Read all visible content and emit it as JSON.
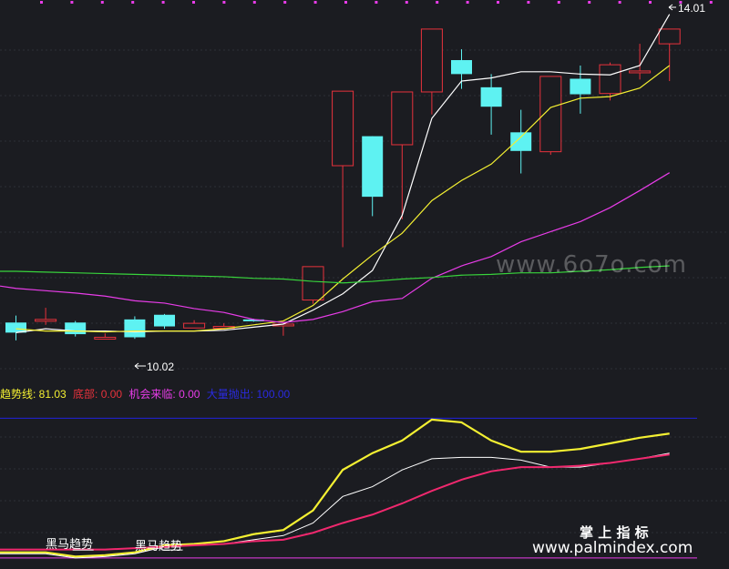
{
  "colors": {
    "background": "#1b1c21",
    "grid": "#2e3038",
    "up": "#e8323c",
    "down": "#5ef2f2",
    "ma5": "#ffffff",
    "ma10": "#f4f032",
    "ma20": "#e83ce8",
    "ma60": "#38d43c",
    "trend": "#f4f032",
    "pink": "#f0286e",
    "blue_level": "#2222dd",
    "magenta_level": "#e83ce8"
  },
  "price_labels": {
    "high": "14.01",
    "low": "10.02"
  },
  "legend": {
    "trend_label": "趋势线: 81.03",
    "bottom_label": "底部: 0.00",
    "chance_label": "机会来临: 0.00",
    "big_label": "大量抛出: 100.00"
  },
  "signal_texts": {
    "s1": "黑马趋势",
    "s2": "黑马趋势"
  },
  "watermarks": {
    "mid": "www.6o7o.com",
    "brand": "掌 上 指 标",
    "site": "www.palmindex.com"
  },
  "chart_data": [
    {
      "type": "candlestick",
      "ylim": [
        9.6,
        14.22
      ],
      "candles": [
        {
          "o": 10.23,
          "h": 10.32,
          "l": 10.0,
          "c": 10.1
        },
        {
          "o": 10.27,
          "h": 10.42,
          "l": 10.2,
          "c": 10.27
        },
        {
          "o": 10.23,
          "h": 10.25,
          "l": 10.05,
          "c": 10.08
        },
        {
          "o": 10.04,
          "h": 10.09,
          "l": 10.02,
          "c": 10.04
        },
        {
          "o": 10.27,
          "h": 10.31,
          "l": 10.02,
          "c": 10.04
        },
        {
          "o": 10.33,
          "h": 10.34,
          "l": 10.15,
          "c": 10.18
        },
        {
          "o": 10.16,
          "h": 10.26,
          "l": 10.16,
          "c": 10.22
        },
        {
          "o": 10.18,
          "h": 10.22,
          "l": 10.14,
          "c": 10.18
        },
        {
          "o": 10.27,
          "h": 10.28,
          "l": 10.24,
          "c": 10.26
        },
        {
          "o": 10.21,
          "h": 10.24,
          "l": 10.06,
          "c": 10.21
        },
        {
          "o": 10.52,
          "h": 10.95,
          "l": 10.47,
          "c": 10.95
        },
        {
          "o": 12.25,
          "h": 13.21,
          "l": 11.2,
          "c": 13.21
        },
        {
          "o": 12.63,
          "h": 12.63,
          "l": 11.6,
          "c": 11.85
        },
        {
          "o": 12.52,
          "h": 13.2,
          "l": 11.56,
          "c": 13.2
        },
        {
          "o": 13.2,
          "h": 14.01,
          "l": 12.91,
          "c": 14.01
        },
        {
          "o": 13.61,
          "h": 13.75,
          "l": 13.24,
          "c": 13.43
        },
        {
          "o": 13.26,
          "h": 13.43,
          "l": 12.65,
          "c": 13.01
        },
        {
          "o": 12.68,
          "h": 12.97,
          "l": 12.15,
          "c": 12.44
        },
        {
          "o": 12.43,
          "h": 13.4,
          "l": 12.39,
          "c": 13.4
        },
        {
          "o": 13.37,
          "h": 13.54,
          "l": 12.92,
          "c": 13.17
        },
        {
          "o": 13.18,
          "h": 13.58,
          "l": 13.09,
          "c": 13.55
        },
        {
          "o": 13.47,
          "h": 13.82,
          "l": 13.36,
          "c": 13.47
        },
        {
          "o": 13.82,
          "h": 14.01,
          "l": 13.34,
          "c": 14.01
        }
      ],
      "ma": [
        {
          "key": "ma5",
          "values": [
            10.1,
            10.15,
            10.12,
            10.12,
            10.11,
            10.12,
            10.12,
            10.13,
            10.17,
            10.21,
            10.39,
            10.6,
            10.9,
            11.61,
            12.86,
            13.34,
            13.38,
            13.46,
            13.46,
            13.43,
            13.42,
            13.54,
            14.2
          ]
        },
        {
          "key": "ma10",
          "values": [
            10.15,
            10.12,
            10.12,
            10.11,
            10.12,
            10.12,
            10.12,
            10.15,
            10.2,
            10.25,
            10.45,
            10.79,
            11.1,
            11.38,
            11.8,
            12.06,
            12.27,
            12.62,
            13.0,
            13.12,
            13.14,
            13.25,
            13.54
          ]
        },
        {
          "key": "ma20",
          "values": [
            10.67,
            10.64,
            10.61,
            10.57,
            10.51,
            10.48,
            10.41,
            10.36,
            10.27,
            10.23,
            10.27,
            10.37,
            10.5,
            10.54,
            10.8,
            10.96,
            11.08,
            11.27,
            11.4,
            11.53,
            11.71,
            11.93,
            12.16
          ]
        },
        {
          "key": "ma60",
          "values": [
            10.89,
            10.88,
            10.87,
            10.86,
            10.85,
            10.84,
            10.83,
            10.82,
            10.8,
            10.79,
            10.76,
            10.74,
            10.76,
            10.79,
            10.81,
            10.84,
            10.85,
            10.87,
            10.87,
            10.89,
            10.91,
            10.94,
            10.96
          ]
        }
      ]
    },
    {
      "type": "line",
      "ylim": [
        -4,
        110
      ],
      "series": [
        {
          "key": "trend",
          "values": [
            4,
            4,
            1,
            2,
            4,
            9,
            10,
            12,
            17,
            20,
            34,
            63,
            75,
            84,
            99,
            97,
            84,
            76,
            76,
            78,
            82,
            86,
            89
          ]
        },
        {
          "key": "white",
          "values": [
            3,
            3,
            0,
            1,
            3,
            8,
            9,
            10,
            13,
            16,
            25,
            44,
            51,
            63,
            71,
            72,
            72,
            70,
            65,
            65,
            68,
            71,
            75
          ]
        },
        {
          "key": "pink",
          "values": [
            6,
            6,
            6,
            6,
            7,
            8,
            9,
            10,
            12,
            13,
            18,
            25,
            31,
            39,
            48,
            56,
            62,
            65,
            65,
            66,
            68,
            71,
            74
          ]
        }
      ],
      "levels": {
        "blue": 100,
        "magenta": 0
      },
      "signals": [
        {
          "i": 2,
          "v": 7
        },
        {
          "i": 5,
          "v": 7
        }
      ]
    }
  ]
}
